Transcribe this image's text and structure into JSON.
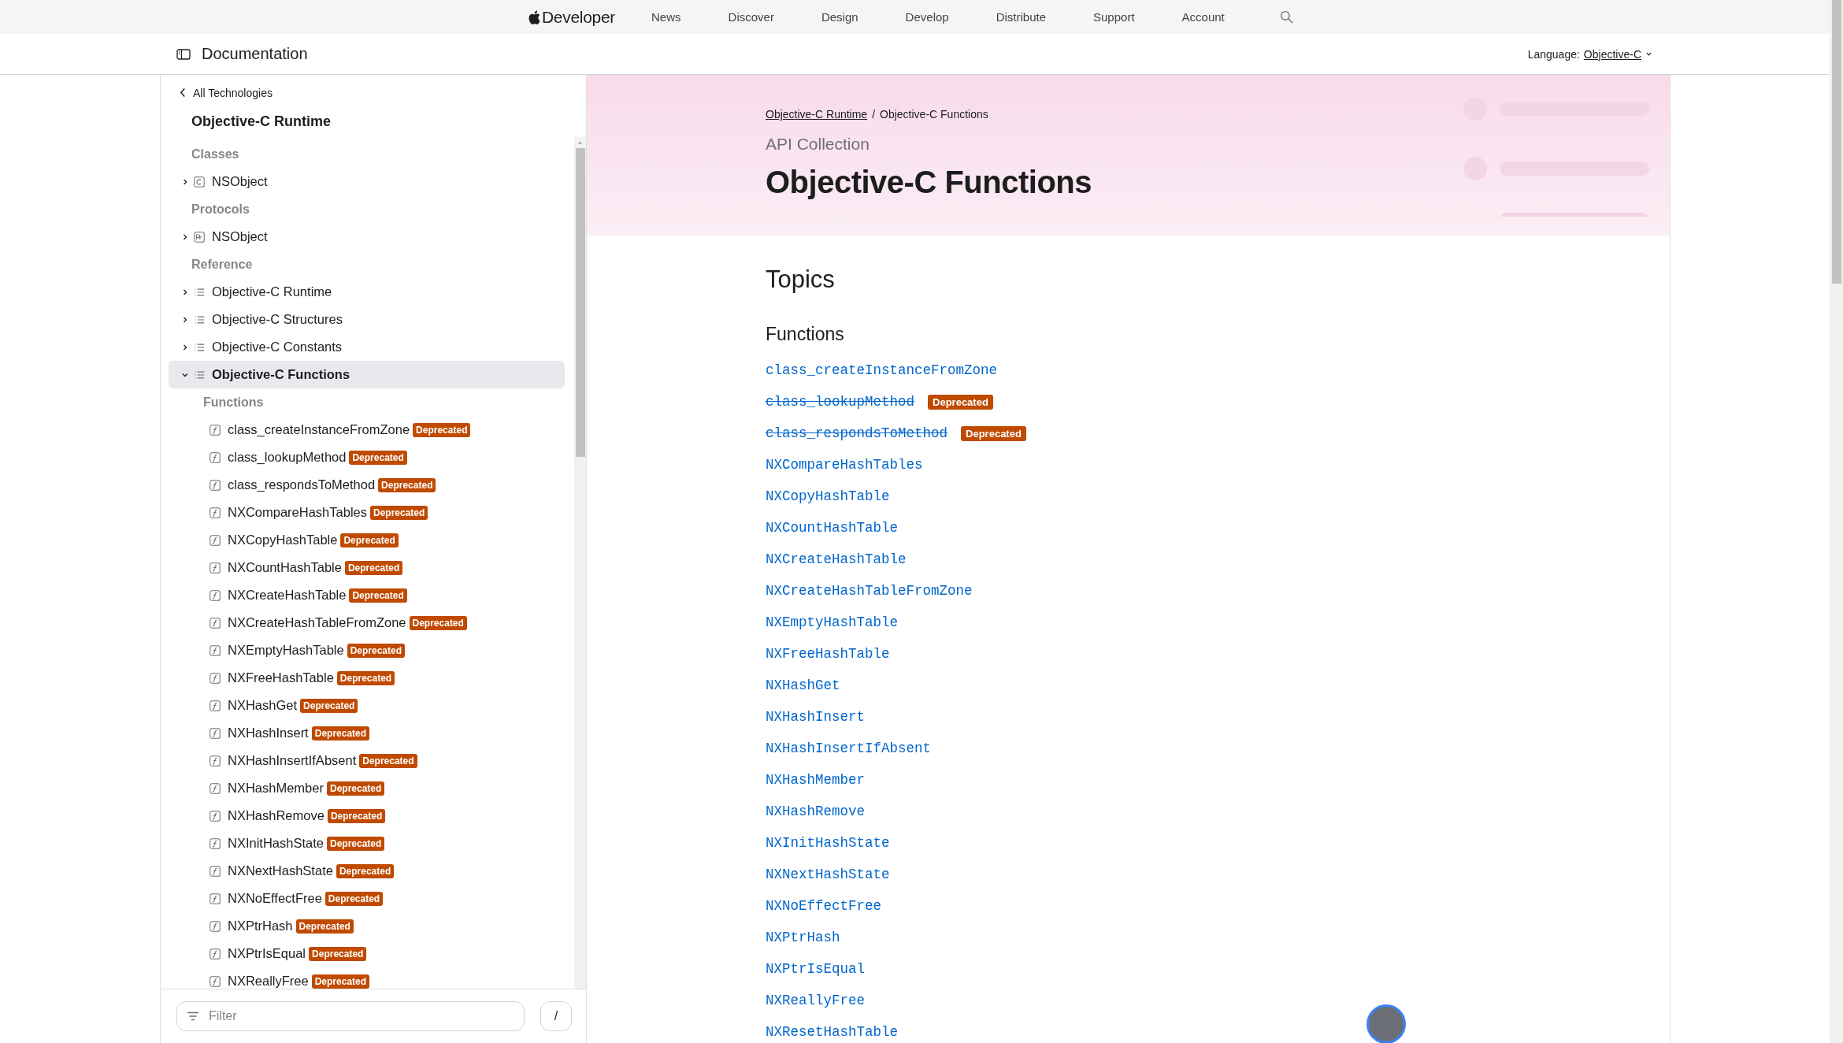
{
  "top_nav": {
    "brand": "Developer",
    "links": [
      "News",
      "Discover",
      "Design",
      "Develop",
      "Distribute",
      "Support",
      "Account"
    ]
  },
  "doc_bar": {
    "title": "Documentation",
    "language_label": "Language:",
    "language_value": "Objective-C"
  },
  "sidebar": {
    "back_link": "All Technologies",
    "title": "Objective-C Runtime",
    "items": [
      {
        "kind": "heading",
        "label": "Classes"
      },
      {
        "kind": "class",
        "label": "NSObject",
        "expanded": false,
        "selected": false
      },
      {
        "kind": "heading",
        "label": "Protocols"
      },
      {
        "kind": "protocol",
        "label": "NSObject",
        "expanded": false,
        "selected": false
      },
      {
        "kind": "heading",
        "label": "Reference"
      },
      {
        "kind": "collection",
        "label": "Objective-C Runtime",
        "expanded": false,
        "selected": false
      },
      {
        "kind": "collection",
        "label": "Objective-C Structures",
        "expanded": false,
        "selected": false
      },
      {
        "kind": "collection",
        "label": "Objective-C Constants",
        "expanded": false,
        "selected": false
      },
      {
        "kind": "collection",
        "label": "Objective-C Functions",
        "expanded": true,
        "selected": true,
        "children": [
          {
            "kind": "heading",
            "label": "Functions"
          },
          {
            "kind": "function",
            "label": "class_createInstanceFromZone",
            "badge": "Deprecated",
            "selected": false
          },
          {
            "kind": "function",
            "label": "class_lookupMethod",
            "badge": "Deprecated",
            "selected": false
          },
          {
            "kind": "function",
            "label": "class_respondsToMethod",
            "badge": "Deprecated",
            "selected": false
          },
          {
            "kind": "function",
            "label": "NXCompareHashTables",
            "badge": "Deprecated",
            "selected": false
          },
          {
            "kind": "function",
            "label": "NXCopyHashTable",
            "badge": "Deprecated",
            "selected": false
          },
          {
            "kind": "function",
            "label": "NXCountHashTable",
            "badge": "Deprecated",
            "selected": false
          },
          {
            "kind": "function",
            "label": "NXCreateHashTable",
            "badge": "Deprecated",
            "selected": false
          },
          {
            "kind": "function",
            "label": "NXCreateHashTableFromZone",
            "badge": "Deprecated",
            "selected": false
          },
          {
            "kind": "function",
            "label": "NXEmptyHashTable",
            "badge": "Deprecated",
            "selected": false
          },
          {
            "kind": "function",
            "label": "NXFreeHashTable",
            "badge": "Deprecated",
            "selected": false
          },
          {
            "kind": "function",
            "label": "NXHashGet",
            "badge": "Deprecated",
            "selected": false
          },
          {
            "kind": "function",
            "label": "NXHashInsert",
            "badge": "Deprecated",
            "selected": false
          },
          {
            "kind": "function",
            "label": "NXHashInsertIfAbsent",
            "badge": "Deprecated",
            "selected": false
          },
          {
            "kind": "function",
            "label": "NXHashMember",
            "badge": "Deprecated",
            "selected": false
          },
          {
            "kind": "function",
            "label": "NXHashRemove",
            "badge": "Deprecated",
            "selected": false
          },
          {
            "kind": "function",
            "label": "NXInitHashState",
            "badge": "Deprecated",
            "selected": false
          },
          {
            "kind": "function",
            "label": "NXNextHashState",
            "badge": "Deprecated",
            "selected": false
          },
          {
            "kind": "function",
            "label": "NXNoEffectFree",
            "badge": "Deprecated",
            "selected": false
          },
          {
            "kind": "function",
            "label": "NXPtrHash",
            "badge": "Deprecated",
            "selected": false
          },
          {
            "kind": "function",
            "label": "NXPtrIsEqual",
            "badge": "Deprecated",
            "selected": false
          },
          {
            "kind": "function",
            "label": "NXReallyFree",
            "badge": "Deprecated",
            "selected": false
          }
        ]
      }
    ],
    "filter": {
      "placeholder": "Filter"
    },
    "shortcut_key": "/"
  },
  "hero": {
    "breadcrumbs": [
      {
        "label": "Objective-C Runtime",
        "link": true
      },
      {
        "label": "Objective-C Functions",
        "link": false
      }
    ],
    "separator": "/",
    "eyebrow": "API Collection",
    "title": "Objective-C Functions"
  },
  "topics": {
    "title": "Topics",
    "sections": [
      {
        "title": "Functions",
        "items": [
          {
            "label": "class_createInstanceFromZone",
            "deprecated": false
          },
          {
            "label": "class_lookupMethod",
            "deprecated": true,
            "badge": "Deprecated"
          },
          {
            "label": "class_respondsToMethod",
            "deprecated": true,
            "badge": "Deprecated"
          },
          {
            "label": "NXCompareHashTables",
            "deprecated": false
          },
          {
            "label": "NXCopyHashTable",
            "deprecated": false
          },
          {
            "label": "NXCountHashTable",
            "deprecated": false
          },
          {
            "label": "NXCreateHashTable",
            "deprecated": false
          },
          {
            "label": "NXCreateHashTableFromZone",
            "deprecated": false
          },
          {
            "label": "NXEmptyHashTable",
            "deprecated": false
          },
          {
            "label": "NXFreeHashTable",
            "deprecated": false
          },
          {
            "label": "NXHashGet",
            "deprecated": false
          },
          {
            "label": "NXHashInsert",
            "deprecated": false
          },
          {
            "label": "NXHashInsertIfAbsent",
            "deprecated": false
          },
          {
            "label": "NXHashMember",
            "deprecated": false
          },
          {
            "label": "NXHashRemove",
            "deprecated": false
          },
          {
            "label": "NXInitHashState",
            "deprecated": false
          },
          {
            "label": "NXNextHashState",
            "deprecated": false
          },
          {
            "label": "NXNoEffectFree",
            "deprecated": false
          },
          {
            "label": "NXPtrHash",
            "deprecated": false
          },
          {
            "label": "NXPtrIsEqual",
            "deprecated": false
          },
          {
            "label": "NXReallyFree",
            "deprecated": false
          },
          {
            "label": "NXResetHashTable",
            "deprecated": false
          }
        ]
      }
    ]
  }
}
